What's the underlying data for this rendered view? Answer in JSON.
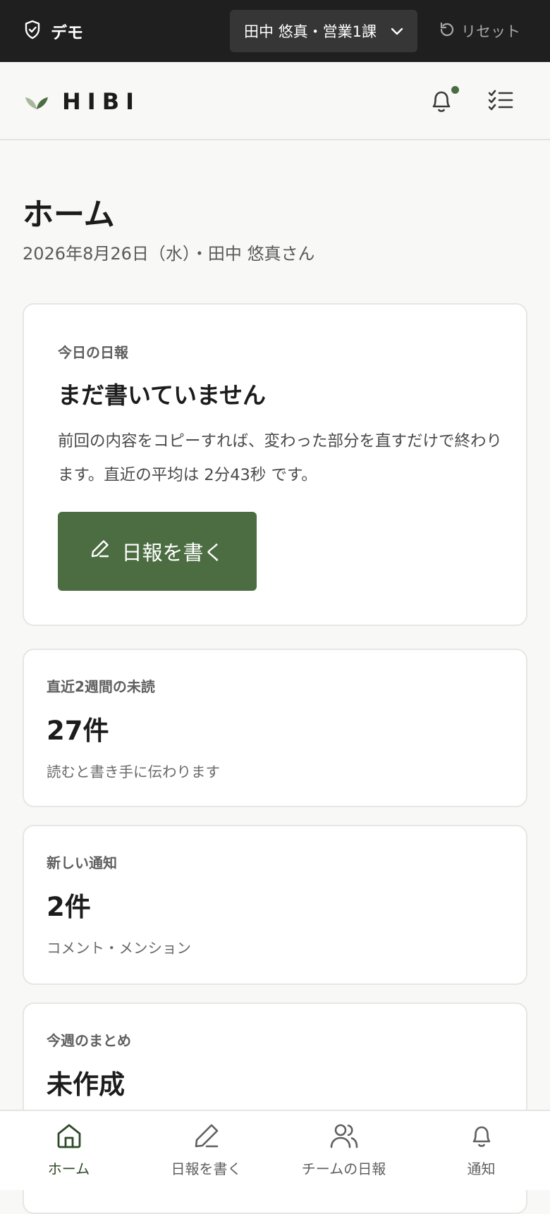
{
  "demo_bar": {
    "badge_label": "デモ",
    "user_select_label": "田中 悠真・営業1課",
    "reset_label": "リセット"
  },
  "header": {
    "logo_text": "HIBI",
    "has_unread_notification": true
  },
  "page": {
    "title": "ホーム",
    "subtitle": "2026年8月26日（水）・田中 悠真さん"
  },
  "today_card": {
    "label": "今日の日報",
    "title": "まだ書いていません",
    "description": "前回の内容をコピーすれば、変わった部分を直すだけで終わります。直近の平均は 2分43秒 です。",
    "button_label": "日報を書く"
  },
  "stats": {
    "unread": {
      "label": "直近2週間の未読",
      "value": "27件",
      "note": "読むと書き手に伝わります"
    },
    "notifications": {
      "label": "新しい通知",
      "value": "2件",
      "note": "コメント・メンション"
    },
    "weekly": {
      "label": "今週のまとめ",
      "value": "未作成"
    }
  },
  "bottom_nav": {
    "items": [
      {
        "label": "ホーム",
        "icon": "home-icon",
        "active": true
      },
      {
        "label": "日報を書く",
        "icon": "pencil-icon",
        "active": false
      },
      {
        "label": "チームの日報",
        "icon": "users-icon",
        "active": false
      },
      {
        "label": "通知",
        "icon": "bell-icon",
        "active": false
      }
    ]
  },
  "colors": {
    "accent": "#4b6d41",
    "demo_bar": "#1f1f1f",
    "background": "#f8f8f6"
  }
}
